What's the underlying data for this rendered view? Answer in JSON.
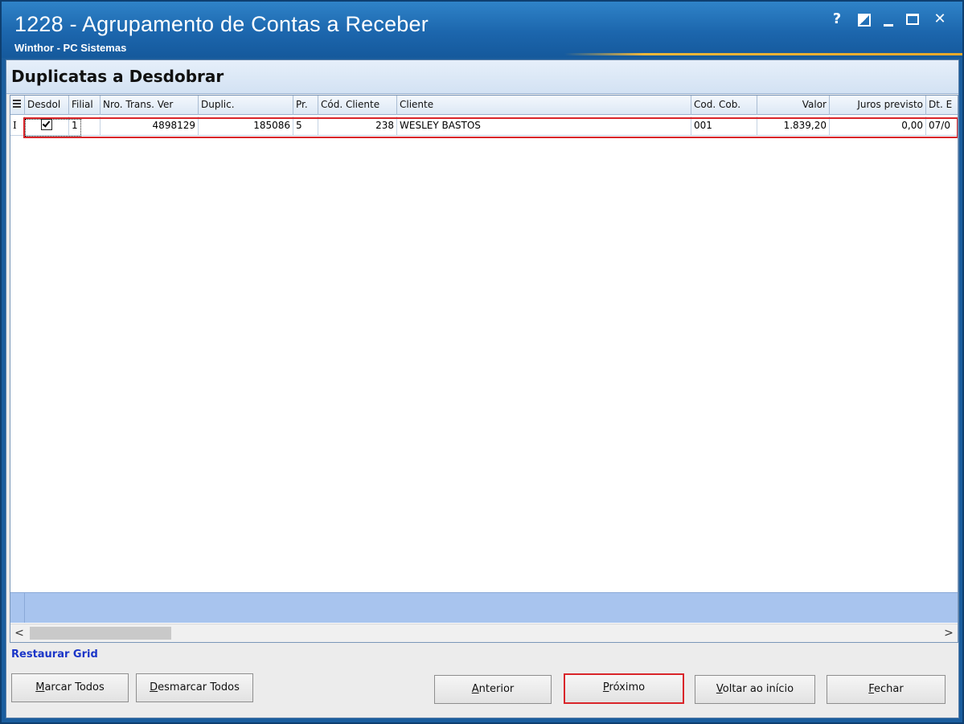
{
  "window": {
    "title": "1228 - Agrupamento de Contas a Receber",
    "subtitle": "Winthor - PC Sistemas",
    "controls": [
      "?",
      "restore",
      "minimize",
      "maximize",
      "close"
    ]
  },
  "section": {
    "title": "Duplicatas a Desdobrar"
  },
  "grid": {
    "columns": [
      {
        "key": "desdob",
        "label": "Desdol"
      },
      {
        "key": "filial",
        "label": "Filial"
      },
      {
        "key": "nro_trans",
        "label": "Nro. Trans. Ver"
      },
      {
        "key": "duplic",
        "label": "Duplic."
      },
      {
        "key": "pr",
        "label": "Pr."
      },
      {
        "key": "cod_cliente",
        "label": "Cód. Cliente"
      },
      {
        "key": "cliente",
        "label": "Cliente"
      },
      {
        "key": "cod_cob",
        "label": "Cod. Cob."
      },
      {
        "key": "valor",
        "label": "Valor"
      },
      {
        "key": "juros_previsto",
        "label": "Juros previsto"
      },
      {
        "key": "dt",
        "label": "Dt. E"
      }
    ],
    "rows": [
      {
        "indicator": "I",
        "desdob_checked": true,
        "filial": "1",
        "nro_trans": "4898129",
        "duplic": "185086",
        "pr": "5",
        "cod_cliente": "238",
        "cliente": "WESLEY BASTOS",
        "cod_cob": "001",
        "valor": "1.839,20",
        "juros_previsto": "0,00",
        "dt": "07/0"
      }
    ]
  },
  "links": {
    "restore_grid": "Restaurar Grid"
  },
  "buttons": {
    "marcar_todos": {
      "accel": "M",
      "rest": "arcar Todos"
    },
    "desmarcar_todos": {
      "accel": "D",
      "rest": "esmarcar Todos"
    },
    "anterior": {
      "accel": "A",
      "rest": "nterior"
    },
    "proximo": {
      "accel": "P",
      "rest": "róximo"
    },
    "voltar": {
      "accel": "V",
      "rest": "oltar ao início"
    },
    "fechar": {
      "accel": "F",
      "rest": "echar"
    }
  },
  "colors": {
    "title_bar": "#1c66ad",
    "highlight_border": "#d9252a",
    "link": "#1a35c8",
    "footer_band": "#a8c4ee"
  }
}
